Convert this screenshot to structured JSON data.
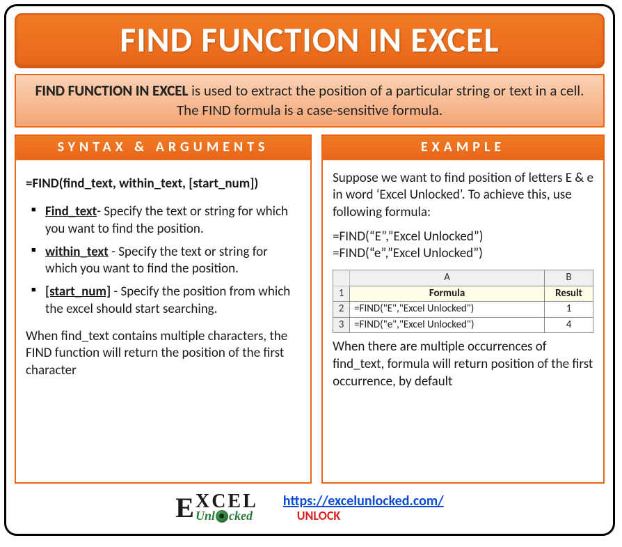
{
  "title": "FIND FUNCTION IN EXCEL",
  "description": {
    "lead": "FIND FUNCTION IN EXCEL",
    "rest": " is used to extract the position of a particular string or text in a cell. The FIND formula is a case-sensitive formula."
  },
  "left": {
    "header": "SYNTAX & ARGUMENTS",
    "syntax": "=FIND(find_text, within_text, [start_num])",
    "args": [
      {
        "name": "Find_text",
        "desc": "- Specify the text or string for which you want to find the position."
      },
      {
        "name": "within_text",
        "desc": " - Specify the text or string for which you want to find the position."
      },
      {
        "name": "[start_num]",
        "desc": " - Specify the position from which the excel should start searching."
      }
    ],
    "note": "When find_text contains multiple characters, the FIND function will return the position of the first character"
  },
  "right": {
    "header": "EXAMPLE",
    "intro": "Suppose we want to find position of letters E & e in word ‘Excel Unlocked’. To achieve this, use following formula:",
    "formulas": [
      "=FIND(“E”,”Excel Unlocked”)",
      "=FIND(“e”,”Excel Unlocked”)"
    ],
    "table": {
      "cols": [
        "A",
        "B"
      ],
      "headers": [
        "Formula",
        "Result"
      ],
      "rows": [
        {
          "n": "2",
          "a": "=FIND(\"E\",\"Excel Unlocked\")",
          "b": "1"
        },
        {
          "n": "3",
          "a": "=FIND(\"e\",\"Excel Unlocked\")",
          "b": "4"
        }
      ],
      "row1": "1"
    },
    "note": "When there are multiple occurrences of find_text, formula will return position of the first occurrence, by default"
  },
  "footer": {
    "logo_top": "XCEL",
    "logo_e": "E",
    "logo_un": "Unl",
    "logo_cked": "cked",
    "url": "https://excelunlocked.com/",
    "unlock": "UNLOCK"
  }
}
